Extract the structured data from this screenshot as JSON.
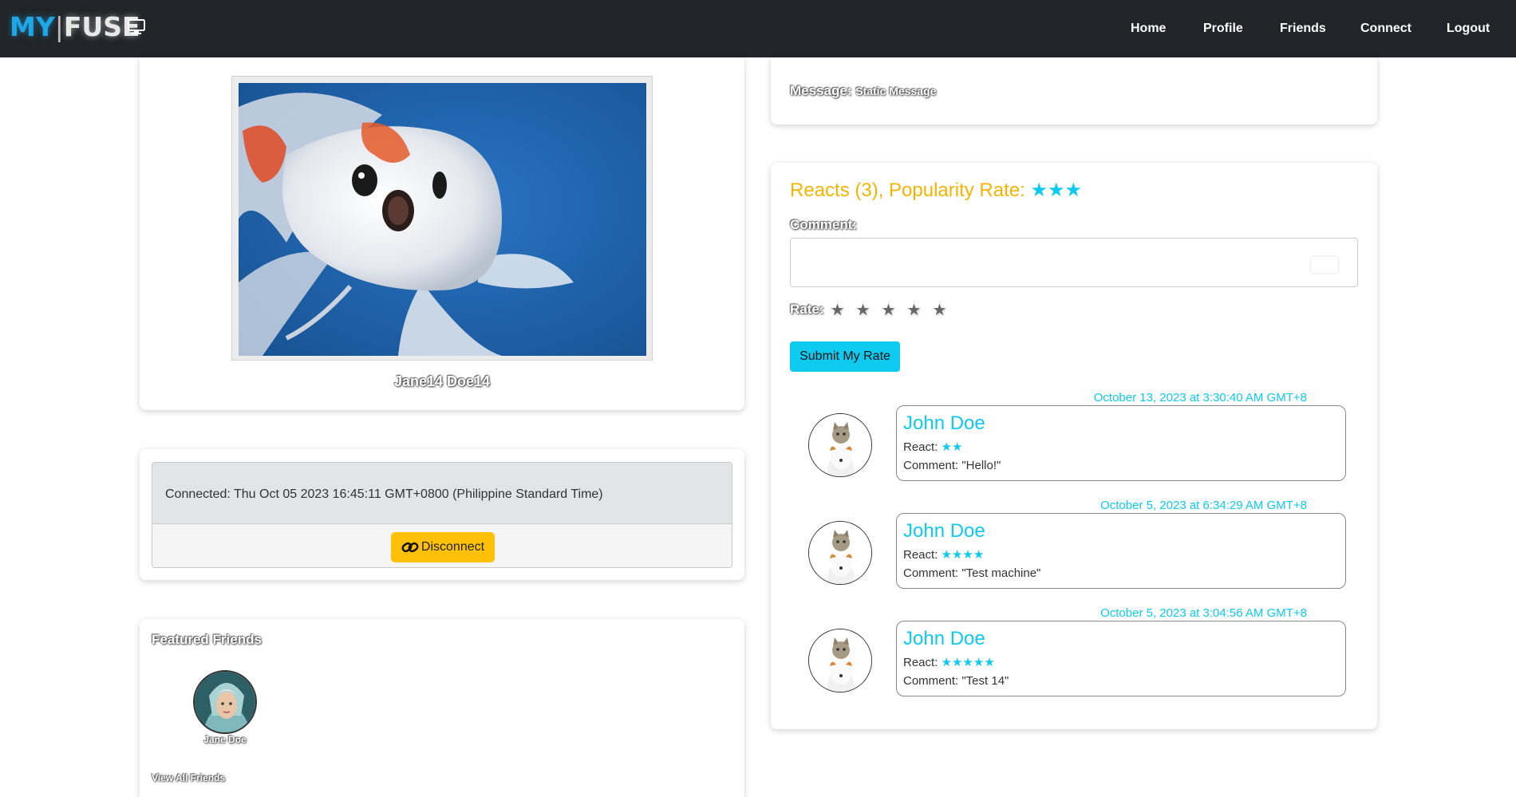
{
  "brand": {
    "my": "MY",
    "separator": "|",
    "fuse": "FUSE"
  },
  "nav": {
    "home": "Home",
    "profile": "Profile",
    "friends": "Friends",
    "connect": "Connect",
    "logout": "Logout"
  },
  "profile": {
    "name": "Jane14 Doe14"
  },
  "connection": {
    "text": "Connected: Thu Oct 05 2023 16:45:11 GMT+0800 (Philippine Standard Time)",
    "disconnect_label": "Disconnect"
  },
  "featured": {
    "title": "Featured Friends",
    "friends": [
      {
        "name": "Jane Doe"
      }
    ],
    "view_all": "View All Friends"
  },
  "message": {
    "label": "Message:",
    "value": "Static Message"
  },
  "reacts": {
    "title_prefix": "Reacts (3),  Popularity Rate:",
    "popularity_stars": "★★★",
    "comment_label": "Comment:",
    "rate_label": "Rate:",
    "rate_stars": [
      "★",
      "★",
      "★",
      "★",
      "★"
    ],
    "submit_label": "Submit My Rate"
  },
  "comments": [
    {
      "date": "October 13, 2023 at 3:30:40 AM GMT+8",
      "name": "John Doe",
      "react_label": "React:",
      "react": "★★",
      "comment": "Comment: \"Hello!\""
    },
    {
      "date": "October 5, 2023 at 6:34:29 AM GMT+8",
      "name": "John Doe",
      "react_label": "React:",
      "react": "★★★★",
      "comment": "Comment: \"Test machine\""
    },
    {
      "date": "October 5, 2023 at 3:04:56 AM GMT+8",
      "name": "John Doe",
      "react_label": "React:",
      "react": "★★★★★",
      "comment": "Comment: \"Test 14\""
    }
  ],
  "colors": {
    "navbar": "#212529",
    "accent_cyan": "#0dcaf0",
    "accent_yellow": "#ffc107",
    "react_title": "#f4b400"
  }
}
